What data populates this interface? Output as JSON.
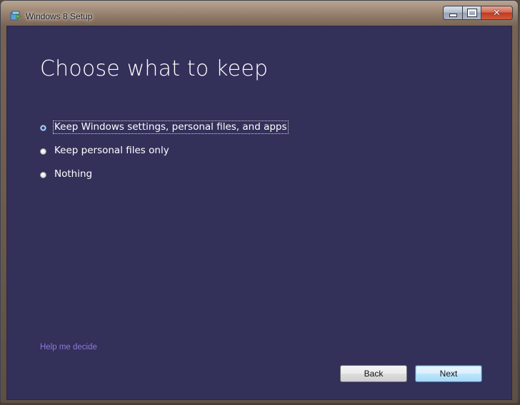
{
  "window": {
    "title": "Windows 8 Setup",
    "icon": "setup-icon",
    "caption_buttons": [
      "minimize-icon",
      "maximize-icon",
      "close-icon"
    ]
  },
  "page": {
    "heading": "Choose what to keep",
    "options": [
      {
        "label": "Keep Windows settings, personal files, and apps",
        "selected": true
      },
      {
        "label": "Keep personal files only",
        "selected": false
      },
      {
        "label": "Nothing",
        "selected": false
      }
    ],
    "help_link": "Help me decide"
  },
  "footer": {
    "back_label": "Back",
    "next_label": "Next"
  },
  "colors": {
    "content_background": "#33305a",
    "heading_text": "#ffffff",
    "link": "#8b7bd8"
  }
}
